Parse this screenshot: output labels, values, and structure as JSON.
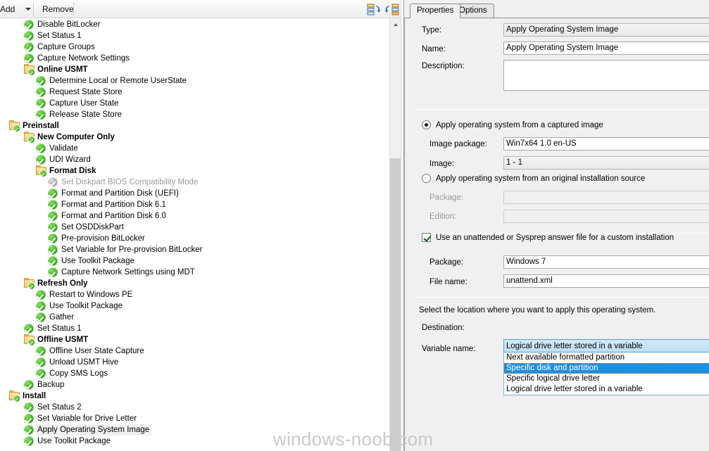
{
  "toolbar": {
    "add_label": "Add",
    "remove_label": "Remove",
    "caret_icon": "chevron-down-icon",
    "collapse_icon": "collapse-all-icon",
    "expand_icon": "expand-all-icon"
  },
  "tree": {
    "nodes": [
      {
        "label": "Disable BitLocker",
        "depth": 1,
        "icon": "task-check-icon",
        "bold": false,
        "disabled": false,
        "selected": false
      },
      {
        "label": "Set Status 1",
        "depth": 1,
        "icon": "task-check-icon",
        "bold": false,
        "disabled": false,
        "selected": false
      },
      {
        "label": "Capture Groups",
        "depth": 1,
        "icon": "task-check-icon",
        "bold": false,
        "disabled": false,
        "selected": false
      },
      {
        "label": "Capture Network Settings",
        "depth": 1,
        "icon": "task-check-icon",
        "bold": false,
        "disabled": false,
        "selected": false
      },
      {
        "label": "Online USMT",
        "depth": 1,
        "icon": "folder-check-icon",
        "bold": true,
        "disabled": false,
        "selected": false
      },
      {
        "label": "Determine Local or Remote UserState",
        "depth": 2,
        "icon": "task-check-icon",
        "bold": false,
        "disabled": false,
        "selected": false
      },
      {
        "label": "Request State Store",
        "depth": 2,
        "icon": "task-check-icon",
        "bold": false,
        "disabled": false,
        "selected": false
      },
      {
        "label": "Capture User State",
        "depth": 2,
        "icon": "task-check-icon",
        "bold": false,
        "disabled": false,
        "selected": false
      },
      {
        "label": "Release State Store",
        "depth": 2,
        "icon": "task-check-icon",
        "bold": false,
        "disabled": false,
        "selected": false
      },
      {
        "label": "Preinstall",
        "depth": 0,
        "icon": "folder-check-icon",
        "bold": true,
        "disabled": false,
        "selected": false
      },
      {
        "label": "New Computer Only",
        "depth": 1,
        "icon": "folder-check-icon",
        "bold": true,
        "disabled": false,
        "selected": false
      },
      {
        "label": "Validate",
        "depth": 2,
        "icon": "task-check-icon",
        "bold": false,
        "disabled": false,
        "selected": false
      },
      {
        "label": "UDI Wizard",
        "depth": 2,
        "icon": "task-check-icon",
        "bold": false,
        "disabled": false,
        "selected": false
      },
      {
        "label": "Format Disk",
        "depth": 2,
        "icon": "folder-check-icon",
        "bold": true,
        "disabled": false,
        "selected": false
      },
      {
        "label": "Set Diskpart BIOS Compatibility Mode",
        "depth": 3,
        "icon": "task-check-icon",
        "bold": false,
        "disabled": true,
        "selected": false
      },
      {
        "label": "Format and Partition Disk (UEFI)",
        "depth": 3,
        "icon": "task-check-icon",
        "bold": false,
        "disabled": false,
        "selected": false
      },
      {
        "label": "Format and Partition Disk 6.1",
        "depth": 3,
        "icon": "task-check-icon",
        "bold": false,
        "disabled": false,
        "selected": false
      },
      {
        "label": "Format and Partition Disk 6.0",
        "depth": 3,
        "icon": "task-check-icon",
        "bold": false,
        "disabled": false,
        "selected": false
      },
      {
        "label": "Set OSDDiskPart",
        "depth": 3,
        "icon": "task-check-icon",
        "bold": false,
        "disabled": false,
        "selected": false
      },
      {
        "label": "Pre-provision BitLocker",
        "depth": 3,
        "icon": "task-check-icon",
        "bold": false,
        "disabled": false,
        "selected": false
      },
      {
        "label": "Set Variable for Pre-provision BitLocker",
        "depth": 3,
        "icon": "task-check-icon",
        "bold": false,
        "disabled": false,
        "selected": false
      },
      {
        "label": "Use Toolkit Package",
        "depth": 3,
        "icon": "task-check-icon",
        "bold": false,
        "disabled": false,
        "selected": false
      },
      {
        "label": "Capture Network Settings using MDT",
        "depth": 3,
        "icon": "task-check-icon",
        "bold": false,
        "disabled": false,
        "selected": false
      },
      {
        "label": "Refresh Only",
        "depth": 1,
        "icon": "folder-check-icon",
        "bold": true,
        "disabled": false,
        "selected": false
      },
      {
        "label": "Restart to Windows PE",
        "depth": 2,
        "icon": "task-check-icon",
        "bold": false,
        "disabled": false,
        "selected": false
      },
      {
        "label": "Use Toolkit Package",
        "depth": 2,
        "icon": "task-check-icon",
        "bold": false,
        "disabled": false,
        "selected": false
      },
      {
        "label": "Gather",
        "depth": 2,
        "icon": "task-check-icon",
        "bold": false,
        "disabled": false,
        "selected": false
      },
      {
        "label": "Set Status 1",
        "depth": 1,
        "icon": "task-check-icon",
        "bold": false,
        "disabled": false,
        "selected": false
      },
      {
        "label": "Offline USMT",
        "depth": 1,
        "icon": "folder-check-icon",
        "bold": true,
        "disabled": false,
        "selected": false
      },
      {
        "label": "Offline User State Capture",
        "depth": 2,
        "icon": "task-check-icon",
        "bold": false,
        "disabled": false,
        "selected": false
      },
      {
        "label": "Unload USMT Hive",
        "depth": 2,
        "icon": "task-check-icon",
        "bold": false,
        "disabled": false,
        "selected": false
      },
      {
        "label": "Copy SMS Logs",
        "depth": 2,
        "icon": "task-check-icon",
        "bold": false,
        "disabled": false,
        "selected": false
      },
      {
        "label": "Backup",
        "depth": 1,
        "icon": "task-check-icon",
        "bold": false,
        "disabled": false,
        "selected": false
      },
      {
        "label": "Install",
        "depth": 0,
        "icon": "folder-check-icon",
        "bold": true,
        "disabled": false,
        "selected": false
      },
      {
        "label": "Set Status 2",
        "depth": 1,
        "icon": "task-check-icon",
        "bold": false,
        "disabled": false,
        "selected": false
      },
      {
        "label": "Set Variable for Drive Letter",
        "depth": 1,
        "icon": "task-check-icon",
        "bold": false,
        "disabled": false,
        "selected": false
      },
      {
        "label": "Apply Operating System Image",
        "depth": 1,
        "icon": "task-check-icon",
        "bold": false,
        "disabled": false,
        "selected": true
      },
      {
        "label": "Use Toolkit Package",
        "depth": 1,
        "icon": "task-check-icon",
        "bold": false,
        "disabled": false,
        "selected": false
      }
    ]
  },
  "properties": {
    "tabs": [
      {
        "label": "Properties",
        "active": true
      },
      {
        "label": "Options",
        "active": false
      }
    ],
    "type_label": "Type:",
    "type_value": "Apply Operating System Image",
    "name_label": "Name:",
    "name_value": "Apply Operating System Image",
    "description_label": "Description:",
    "description_value": "",
    "radio_captured_label": "Apply operating system from a captured image",
    "radio_captured_selected": true,
    "image_package_label": "Image package:",
    "image_package_value": "Win7x64 1.0 en-US",
    "image_label": "Image:",
    "image_value": "1 - 1",
    "radio_original_label": "Apply operating system from an original installation source",
    "radio_original_selected": false,
    "package_label": "Package:",
    "package_value": "",
    "edition_label": "Edition:",
    "edition_value": "",
    "unattend_checkbox_label": "Use an unattended or Sysprep answer file for a custom installation",
    "unattend_checked": true,
    "unattend_package_label": "Package:",
    "unattend_package_value": "Windows 7",
    "file_name_label": "File name:",
    "file_name_value": "unattend.xml",
    "location_hint": "Select the location where you want to apply this operating system.",
    "destination_label": "Destination:",
    "destination_value": "Logical drive letter stored in a variable",
    "variable_name_label": "Variable name:",
    "destination_options": [
      {
        "label": "Next available formatted partition",
        "highlighted": false
      },
      {
        "label": "Specific disk and partition",
        "highlighted": true
      },
      {
        "label": "Specific logical drive letter",
        "highlighted": false
      },
      {
        "label": "Logical drive letter stored in a variable",
        "highlighted": false
      }
    ]
  },
  "annotation": {
    "shape": "hand-drawn-ellipse",
    "color": "#000000"
  },
  "watermark": {
    "text": "windows-noob.com",
    "color": "#c9c9c9"
  }
}
